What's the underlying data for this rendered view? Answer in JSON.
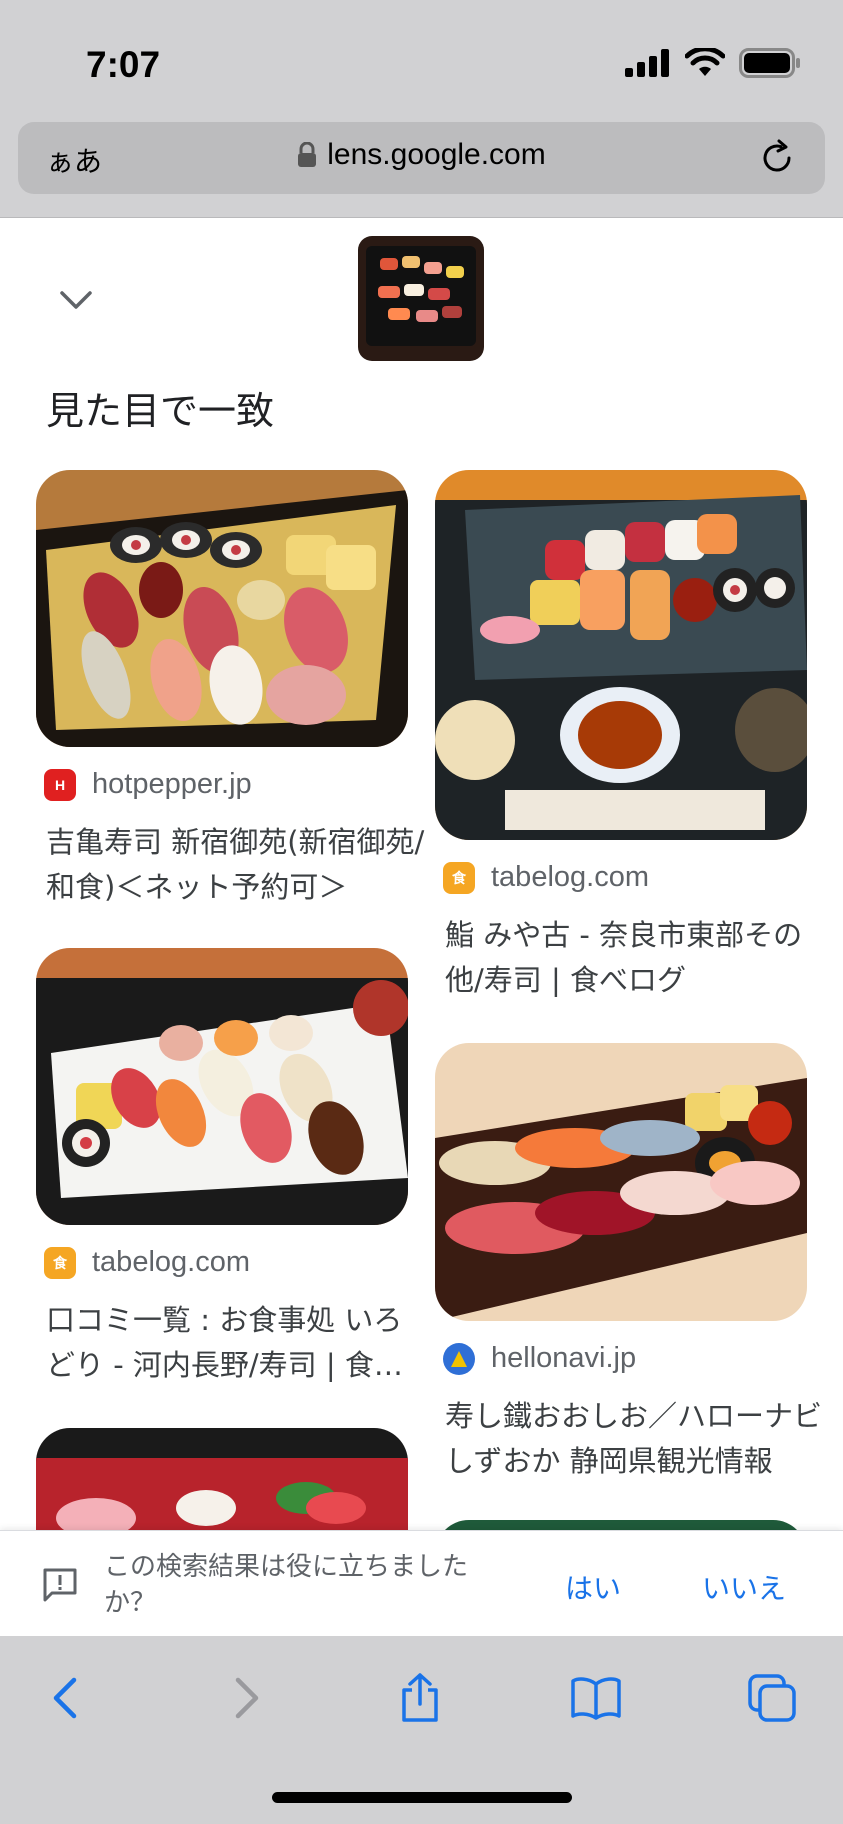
{
  "status_bar": {
    "time": "7:07"
  },
  "address_bar": {
    "text_size_label": "ぁあ",
    "url": "lens.google.com"
  },
  "section_title": "見た目で一致",
  "results": [
    {
      "source": "hotpepper.jp",
      "caption": "吉亀寿司 新宿御苑(新宿御苑/和食)＜ネット予約可＞"
    },
    {
      "source": "tabelog.com",
      "caption": "鮨 みや古 - 奈良市東部その他/寿司 | 食べログ"
    },
    {
      "source": "tabelog.com",
      "caption": "口コミ一覧 : お食事処 いろどり - 河内長野/寿司 | 食べログ"
    },
    {
      "source": "hellonavi.jp",
      "caption": "寿し鐵おおしお／ハローナビしずおか 静岡県観光情報"
    }
  ],
  "feedback": {
    "question": "この検索結果は役に立ちましたか？",
    "yes": "はい",
    "no": "いいえ"
  },
  "colors": {
    "link_blue": "#1a73e8",
    "hotpepper_red": "#e02020",
    "tabelog_orange": "#f5a623",
    "hellonavi_blue": "#2f6fd6"
  },
  "icons": [
    "chevron-down-icon",
    "lock-icon",
    "reload-icon",
    "feedback-icon",
    "back-icon",
    "forward-icon",
    "share-icon",
    "bookmarks-icon",
    "tabs-icon"
  ]
}
